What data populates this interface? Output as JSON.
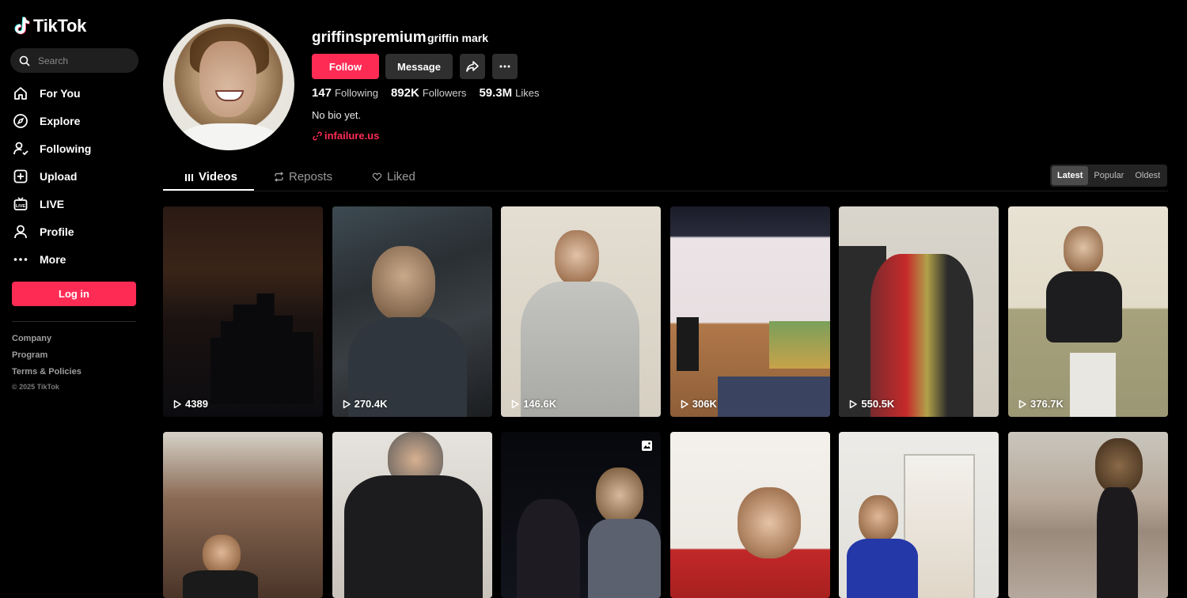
{
  "brand": {
    "name": "TikTok"
  },
  "search": {
    "placeholder": "Search"
  },
  "nav": [
    {
      "label": "For You",
      "icon": "home-icon"
    },
    {
      "label": "Explore",
      "icon": "compass-icon"
    },
    {
      "label": "Following",
      "icon": "following-icon"
    },
    {
      "label": "Upload",
      "icon": "upload-icon"
    },
    {
      "label": "LIVE",
      "icon": "live-icon"
    },
    {
      "label": "Profile",
      "icon": "profile-icon"
    },
    {
      "label": "More",
      "icon": "more-icon"
    }
  ],
  "sidebar": {
    "login_label": "Log in",
    "footer": [
      "Company",
      "Program",
      "Terms & Policies"
    ],
    "copyright": "© 2025 TikTok"
  },
  "profile": {
    "username": "griffinspremium",
    "nickname": "griffin mark",
    "follow_label": "Follow",
    "message_label": "Message",
    "stats": {
      "following": {
        "value": "147",
        "label": "Following"
      },
      "followers": {
        "value": "892K",
        "label": "Followers"
      },
      "likes": {
        "value": "59.3M",
        "label": "Likes"
      }
    },
    "bio": "No bio yet.",
    "link": "infailure.us"
  },
  "tabs": [
    {
      "label": "Videos",
      "active": true
    },
    {
      "label": "Reposts",
      "active": false
    },
    {
      "label": "Liked",
      "active": false
    }
  ],
  "sort": {
    "options": [
      "Latest",
      "Popular",
      "Oldest"
    ],
    "selected": "Latest"
  },
  "videos": [
    {
      "views": "4389"
    },
    {
      "views": "270.4K"
    },
    {
      "views": "146.6K"
    },
    {
      "views": "306K"
    },
    {
      "views": "550.5K"
    },
    {
      "views": "376.7K"
    },
    {
      "views": ""
    },
    {
      "views": ""
    },
    {
      "views": ""
    },
    {
      "views": ""
    },
    {
      "views": ""
    },
    {
      "views": ""
    }
  ],
  "colors": {
    "accent": "#fe2c55",
    "background": "#000000",
    "button_secondary": "#2f2f2f"
  }
}
